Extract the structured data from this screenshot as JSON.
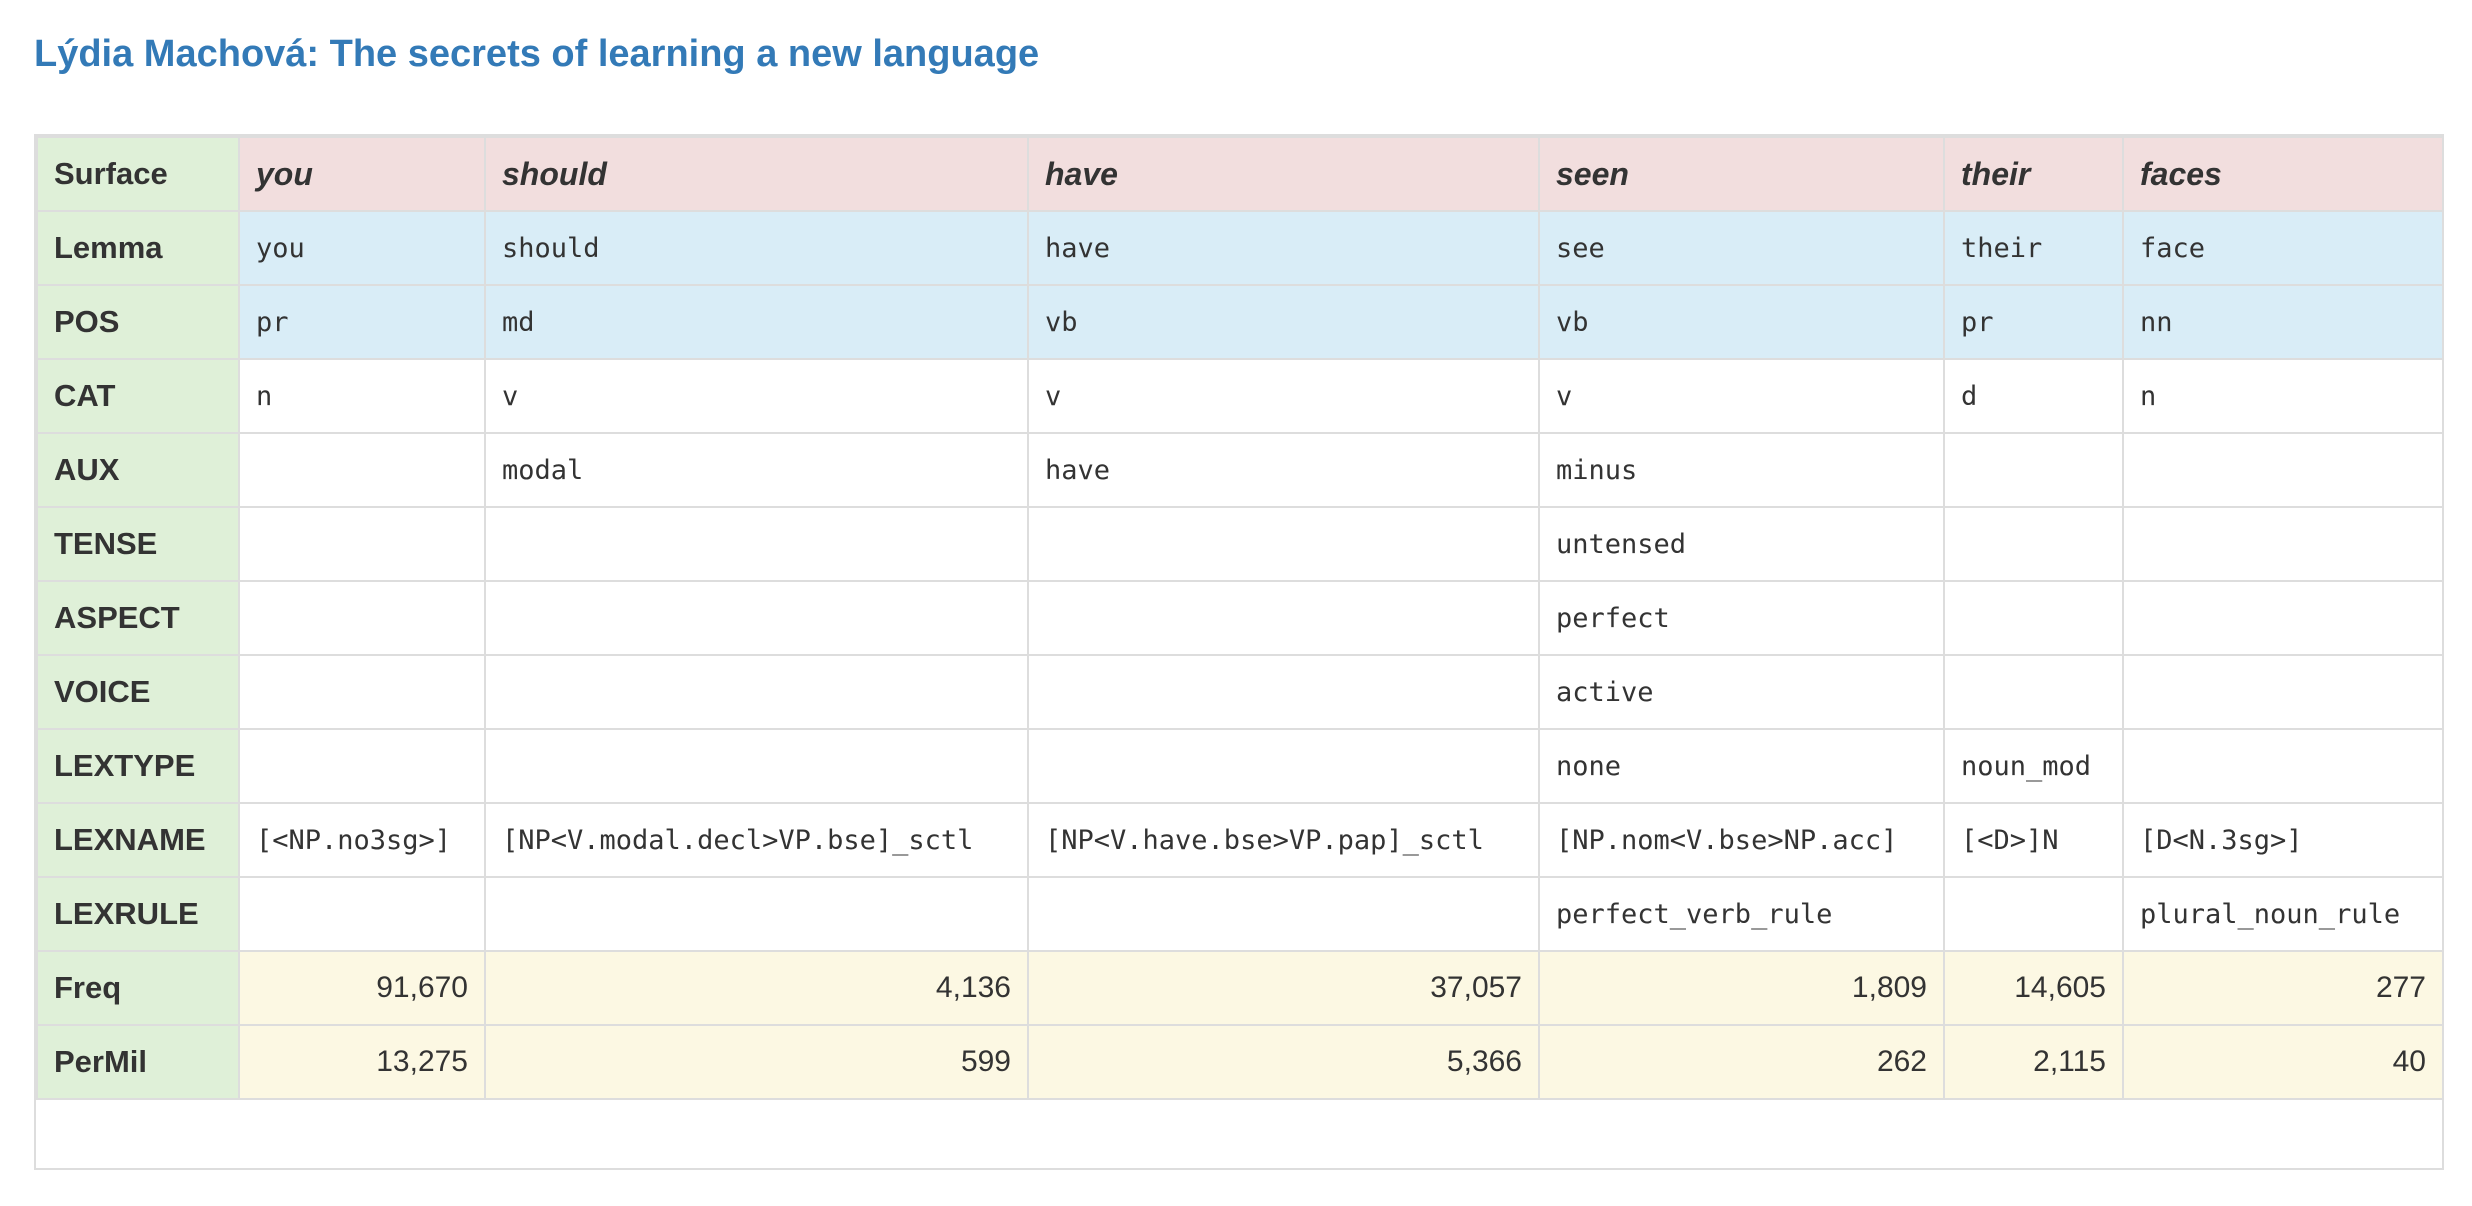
{
  "title": "Lýdia Machová: The secrets of learning a new language",
  "rows": [
    {
      "label": "Surface",
      "cells": [
        "you",
        "should",
        "have",
        "seen",
        "their",
        "faces"
      ]
    },
    {
      "label": "Lemma",
      "cells": [
        "you",
        "should",
        "have",
        "see",
        "their",
        "face"
      ]
    },
    {
      "label": "POS",
      "cells": [
        "pr",
        "md",
        "vb",
        "vb",
        "pr",
        "nn"
      ]
    },
    {
      "label": "CAT",
      "cells": [
        "n",
        "v",
        "v",
        "v",
        "d",
        "n"
      ]
    },
    {
      "label": "AUX",
      "cells": [
        "",
        "modal",
        "have",
        "minus",
        "",
        ""
      ]
    },
    {
      "label": "TENSE",
      "cells": [
        "",
        "",
        "",
        "untensed",
        "",
        ""
      ]
    },
    {
      "label": "ASPECT",
      "cells": [
        "",
        "",
        "",
        "perfect",
        "",
        ""
      ]
    },
    {
      "label": "VOICE",
      "cells": [
        "",
        "",
        "",
        "active",
        "",
        ""
      ]
    },
    {
      "label": "LEXTYPE",
      "cells": [
        "",
        "",
        "",
        "none",
        "noun_mod",
        ""
      ]
    },
    {
      "label": "LEXNAME",
      "cells": [
        "[<NP.no3sg>]",
        "[NP<V.modal.decl>VP.bse]_sctl",
        "[NP<V.have.bse>VP.pap]_sctl",
        "[NP.nom<V.bse>NP.acc]",
        "[<D>]N",
        "[D<N.3sg>]"
      ]
    },
    {
      "label": "LEXRULE",
      "cells": [
        "",
        "",
        "",
        "perfect_verb_rule",
        "",
        "plural_noun_rule"
      ]
    },
    {
      "label": "Freq",
      "cells": [
        "91,670",
        "4,136",
        "37,057",
        "1,809",
        "14,605",
        "277"
      ]
    },
    {
      "label": "PerMil",
      "cells": [
        "13,275",
        "599",
        "5,366",
        "262",
        "2,115",
        "40"
      ]
    }
  ],
  "colors": {
    "title": "#337ab7",
    "label_bg": "#dff0d8",
    "surface_bg": "#f2dede",
    "info_bg": "#d9edf7",
    "numeric_bg": "#fcf8e3",
    "border": "#dddddd"
  }
}
